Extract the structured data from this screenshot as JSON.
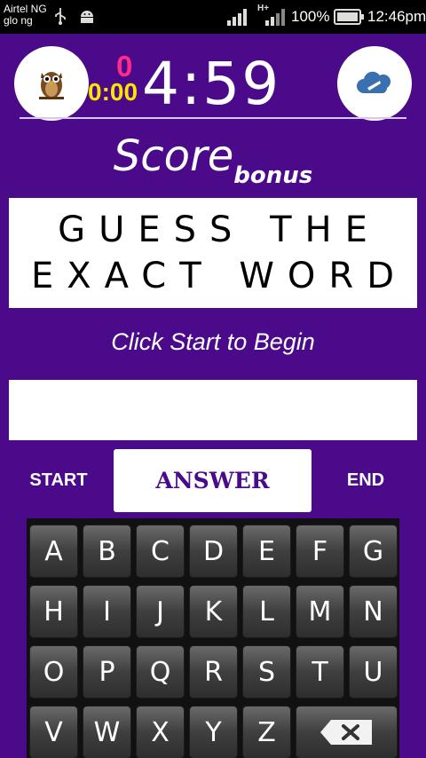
{
  "status_bar": {
    "carrier_line1": "Airtel NG",
    "carrier_line2": "glo ng",
    "network_type": "H+",
    "battery": "100%",
    "time": "12:46pm"
  },
  "header": {
    "small_counter": "0",
    "small_timer": "0:00",
    "main_timer": "4:59",
    "score_label": "Score",
    "bonus_label": "bonus",
    "owl_icon": "owl-icon",
    "cloud_icon": "cloud-icon"
  },
  "word_box": {
    "line1": "GUESS THE",
    "line2": "EXACT WORD"
  },
  "hint": "Click Start to Begin",
  "answer_input": {
    "value": "",
    "placeholder": ""
  },
  "buttons": {
    "start": "START",
    "answer": "ANSWER",
    "end": "END"
  },
  "keyboard": {
    "row1": [
      "A",
      "B",
      "C",
      "D",
      "E",
      "F",
      "G"
    ],
    "row2": [
      "H",
      "I",
      "J",
      "K",
      "L",
      "M",
      "N"
    ],
    "row3": [
      "O",
      "P",
      "Q",
      "R",
      "S",
      "T",
      "U"
    ],
    "row4": [
      "V",
      "W",
      "X",
      "Y",
      "Z"
    ],
    "backspace_icon": "backspace-icon"
  },
  "colors": {
    "background": "#4a0a8a",
    "small_counter": "#ff2a8a",
    "small_timer": "#ffe400"
  }
}
